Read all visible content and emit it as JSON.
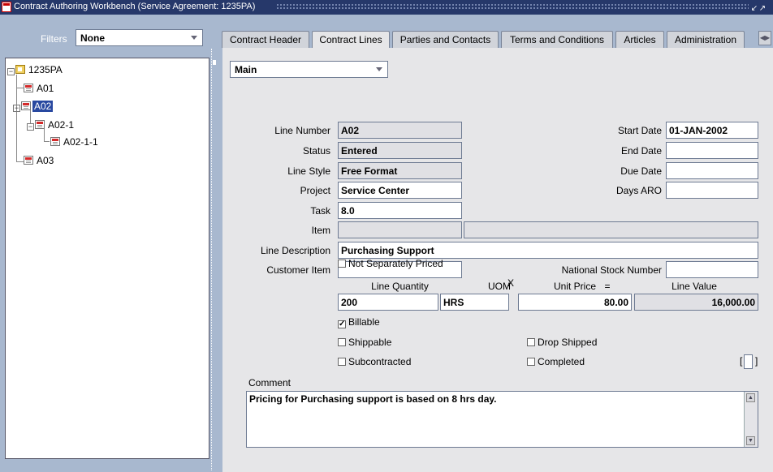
{
  "window": {
    "title": "Contract Authoring Workbench (Service Agreement: 1235PA)"
  },
  "filters": {
    "label": "Filters",
    "value": "None"
  },
  "tree": {
    "root": "1235PA",
    "nodes": [
      "A01",
      "A02",
      "A02-1",
      "A02-1-1",
      "A03"
    ],
    "selected": "A02"
  },
  "tabs": [
    "Contract Header",
    "Contract Lines",
    "Parties and Contacts",
    "Terms and Conditions",
    "Articles",
    "Administration"
  ],
  "active_tab": "Contract Lines",
  "view": {
    "value": "Main"
  },
  "form": {
    "line_number": {
      "label": "Line Number",
      "value": "A02"
    },
    "status": {
      "label": "Status",
      "value": "Entered"
    },
    "line_style": {
      "label": "Line Style",
      "value": "Free Format"
    },
    "project": {
      "label": "Project",
      "value": "Service Center"
    },
    "task": {
      "label": "Task",
      "value": "8.0"
    },
    "item": {
      "label": "Item",
      "value": ""
    },
    "line_description": {
      "label": "Line Description",
      "value": "Purchasing Support"
    },
    "customer_item": {
      "label": "Customer Item",
      "value": ""
    },
    "start_date": {
      "label": "Start Date",
      "value": "01-JAN-2002"
    },
    "end_date": {
      "label": "End Date",
      "value": ""
    },
    "due_date": {
      "label": "Due Date",
      "value": ""
    },
    "days_aro": {
      "label": "Days ARO",
      "value": ""
    },
    "national_stock_number": {
      "label": "National Stock Number",
      "value": ""
    },
    "not_separately_priced": {
      "label": "Not Separately Priced",
      "checked": false
    },
    "quantity_row": {
      "line_quantity_label": "Line Quantity",
      "uom_label": "UOM",
      "times": "X",
      "unit_price_label": "Unit Price",
      "equals": "=",
      "line_value_label": "Line Value",
      "line_quantity": "200",
      "uom": "HRS",
      "unit_price": "80.00",
      "line_value": "16,000.00"
    },
    "billable": {
      "label": "Billable",
      "checked": true
    },
    "shippable": {
      "label": "Shippable",
      "checked": false
    },
    "subcontracted": {
      "label": "Subcontracted",
      "checked": false
    },
    "drop_shipped": {
      "label": "Drop Shipped",
      "checked": false
    },
    "completed": {
      "label": "Completed",
      "checked": false
    },
    "flex_left": "[",
    "flex_right": "]",
    "comment": {
      "label": "Comment",
      "value": "Pricing for Purchasing support is based on 8 hrs day."
    }
  }
}
